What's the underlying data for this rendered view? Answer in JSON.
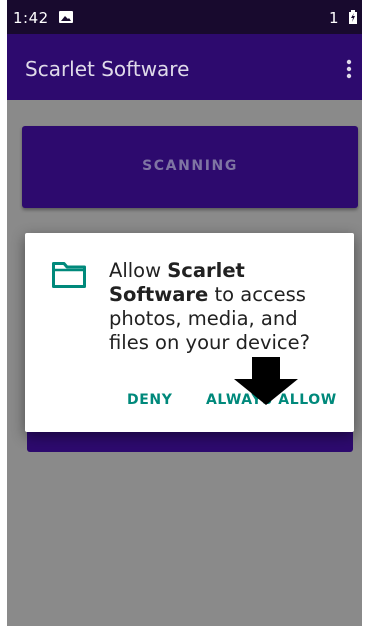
{
  "status_bar": {
    "time": "1:42",
    "notification_icon": "image-icon",
    "sim_indicator": "1",
    "battery_icon": "battery-charging-icon"
  },
  "app_bar": {
    "title": "Scarlet Software",
    "menu_icon": "overflow-menu-icon"
  },
  "main": {
    "scan_button_label": "SCANNING"
  },
  "dialog": {
    "icon": "folder-icon",
    "message_prefix": "Allow ",
    "app_name": "Scarlet Software",
    "message_suffix": " to access photos, media, and files on your device?",
    "deny_label": "DENY",
    "allow_label": "ALWAYS ALLOW"
  },
  "overlay": {
    "pointer_icon": "down-arrow-icon"
  },
  "colors": {
    "primary": "#2d0a6e",
    "status_bar": "#180a2e",
    "accent": "#00897b",
    "scrim_background": "#8a8a8a"
  }
}
